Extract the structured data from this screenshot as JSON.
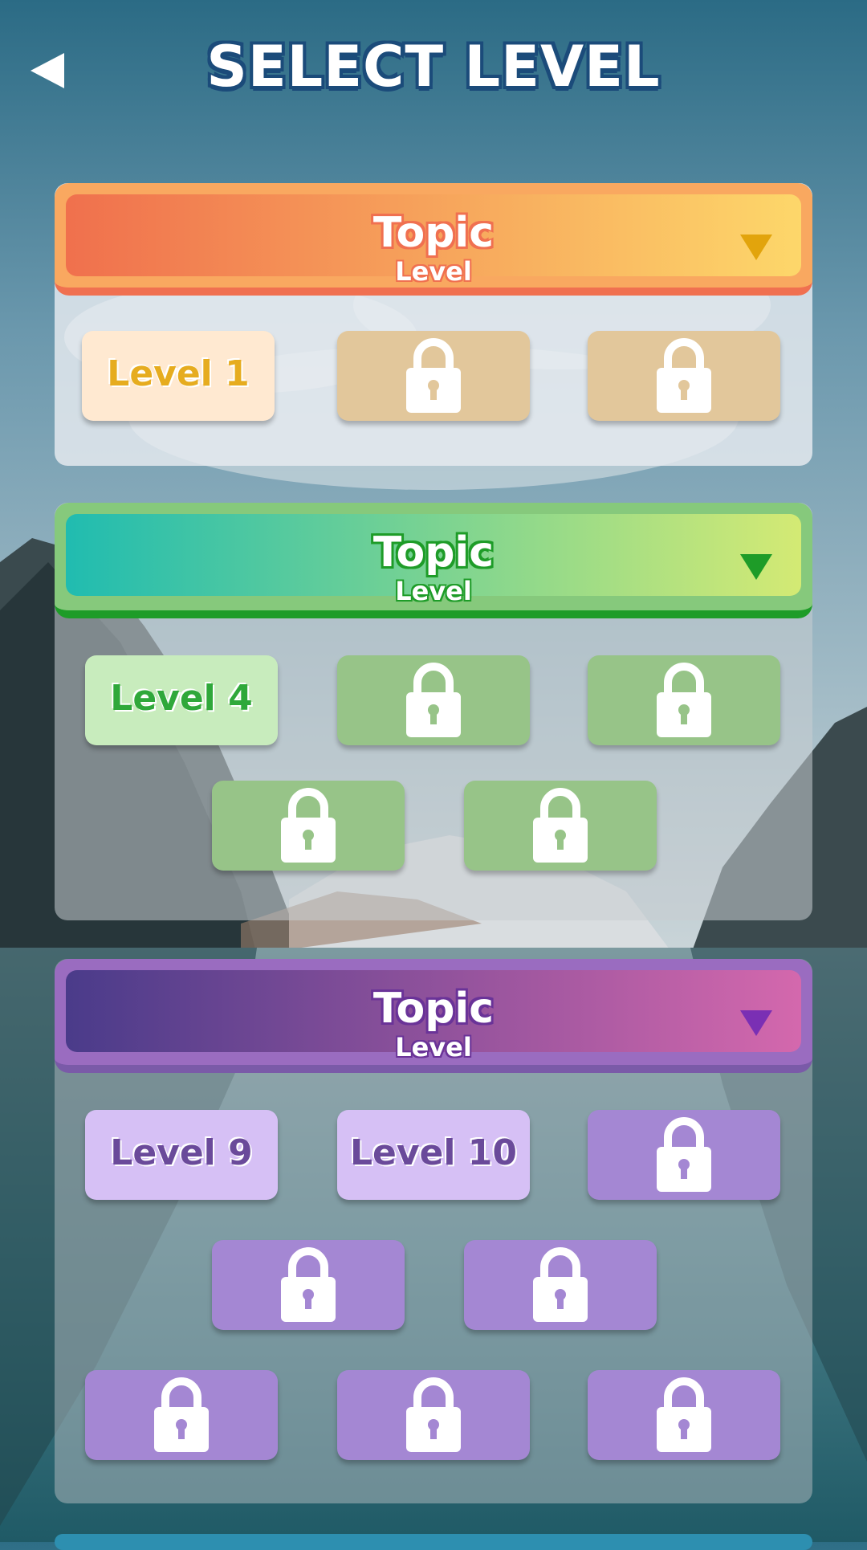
{
  "header": {
    "title": "SELECT LEVEL",
    "back_icon": "back-arrow-icon"
  },
  "topics": [
    {
      "title": "Topic",
      "subtitle": "Level",
      "levels": [
        "Level 1"
      ],
      "locked_count": 2,
      "colors": {
        "header_from": "#f0704d",
        "header_to": "#fdd76a",
        "frame": "#f9a860",
        "shade": "#f07050",
        "arrow": "#e2a40c",
        "title_outline": "#f07050",
        "tile_open": "#ffe9d1",
        "tile_open_text": "#e6ac1f",
        "tile_locked": "#e2c79b"
      }
    },
    {
      "title": "Topic",
      "subtitle": "Level",
      "levels": [
        "Level 4"
      ],
      "locked_count": 4,
      "colors": {
        "header_from": "#20bcb0",
        "header_to": "#d4ea74",
        "frame": "#86c97c",
        "shade": "#1e9c28",
        "arrow": "#1e9c28",
        "title_outline": "#1e9c28",
        "tile_open": "#c8ecbd",
        "tile_open_text": "#2fa83a",
        "tile_locked": "#97c488"
      }
    },
    {
      "title": "Topic",
      "subtitle": "Level",
      "levels": [
        "Level 9",
        "Level 10"
      ],
      "locked_count": 7,
      "colors": {
        "header_from": "#4a3b8a",
        "header_to": "#d468ad",
        "frame": "#9a6cc0",
        "shade": "#7a5aa8",
        "arrow": "#7a2fb4",
        "title_outline": "#6a3398",
        "tile_open": "#d6c0f5",
        "tile_open_text": "#6a4a9a",
        "tile_locked": "#a487d3"
      }
    }
  ]
}
